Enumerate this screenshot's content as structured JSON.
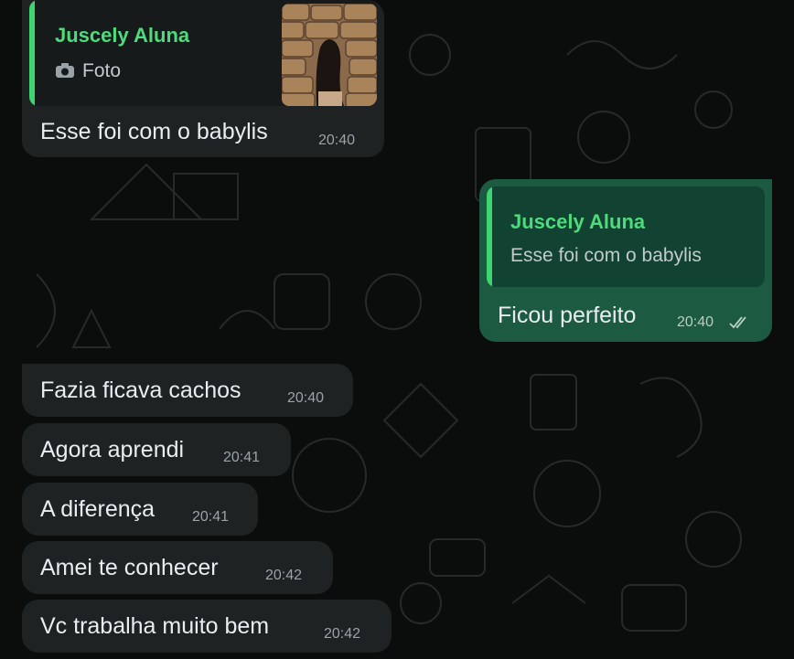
{
  "colors": {
    "incoming_bubble": "#1f2223",
    "outgoing_bubble": "#1c5a42",
    "quote_accent": "#3ed46f",
    "background": "#0b0d0c"
  },
  "messages": [
    {
      "direction": "in",
      "quote": {
        "author": "Juscely Aluna",
        "icon": "camera-icon",
        "text": "Foto",
        "has_thumbnail": true
      },
      "text": "Esse foi com o babylis",
      "time": "20:40"
    },
    {
      "direction": "out",
      "quote": {
        "author": "Juscely Aluna",
        "text": "Esse foi com o babylis"
      },
      "text": "Ficou perfeito",
      "time": "20:40",
      "status_icon": "double-check-icon"
    },
    {
      "direction": "in",
      "text": "Fazia ficava cachos",
      "time": "20:40"
    },
    {
      "direction": "in",
      "text": "Agora aprendi",
      "time": "20:41"
    },
    {
      "direction": "in",
      "text": "A diferença",
      "time": "20:41"
    },
    {
      "direction": "in",
      "text": "Amei te conhecer",
      "time": "20:42"
    },
    {
      "direction": "in",
      "text": "Vc trabalha muito bem",
      "time": "20:42"
    }
  ]
}
